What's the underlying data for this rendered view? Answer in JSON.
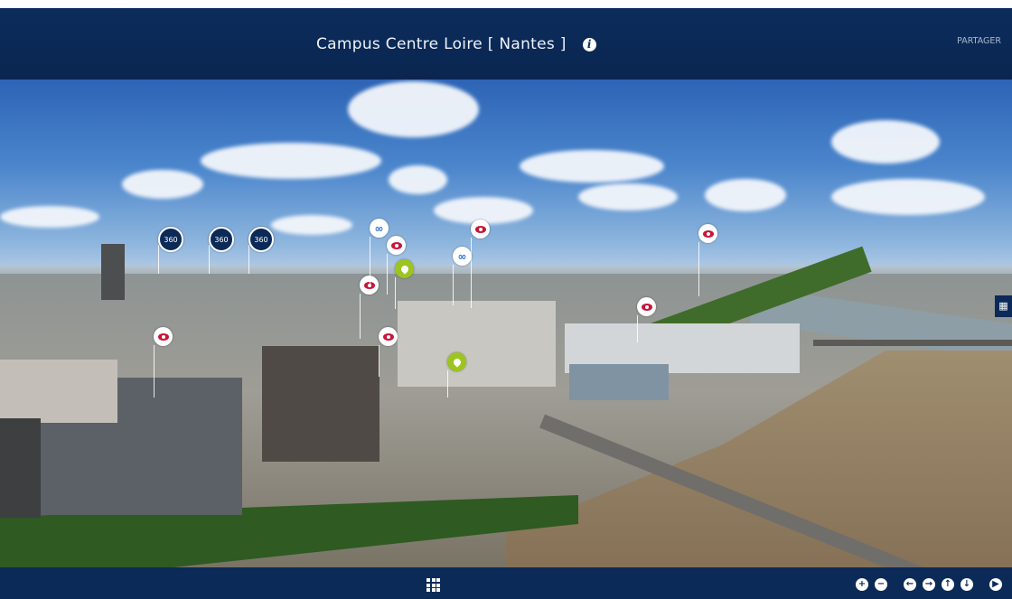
{
  "header": {
    "title": "Campus Centre Loire [ Nantes ]",
    "share_label": "PARTAGER",
    "info_icon": "info-icon"
  },
  "hotspots": {
    "pano360_label": "360",
    "icons": [
      "eye-icon",
      "link-icon",
      "location-pin-icon",
      "panorama-360-icon"
    ]
  },
  "map_badge_icon": "map-icon",
  "footer": {
    "icons": [
      "grid-menu-icon",
      "zoom-in-icon",
      "zoom-out-icon",
      "pan-left-icon",
      "pan-right-icon",
      "pan-up-icon",
      "pan-down-icon",
      "play-icon"
    ],
    "glyphs": {
      "zoom_in": "+",
      "zoom_out": "−",
      "left": "←",
      "right": "→",
      "up": "↑",
      "down": "↓",
      "play": "▶"
    }
  },
  "colors": {
    "bar": "#0b2a58",
    "eye_hotspot": "#c8163a",
    "location_hotspot": "#9cc51f",
    "link_hotspot": "#2a6fcf"
  }
}
